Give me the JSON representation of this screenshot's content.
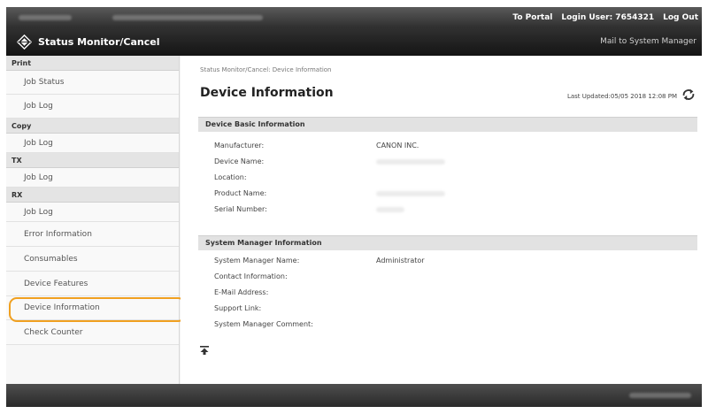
{
  "header": {
    "to_portal": "To Portal",
    "login_user": "Login User: 7654321",
    "log_out": "Log Out"
  },
  "titlebar": {
    "app_title": "Status Monitor/Cancel",
    "mail_link": "Mail to System Manager"
  },
  "sidebar": {
    "sections": [
      {
        "header": "Print",
        "items": [
          "Job Status",
          "Job Log"
        ]
      },
      {
        "header": "Copy",
        "items": [
          "Job Log"
        ]
      },
      {
        "header": "TX",
        "items": [
          "Job Log"
        ]
      },
      {
        "header": "RX",
        "items": [
          "Job Log"
        ]
      }
    ],
    "extra_items": [
      "Error Information",
      "Consumables",
      "Device Features",
      "Device Information",
      "Check Counter"
    ],
    "active_item": "Device Information"
  },
  "main": {
    "breadcrumb": "Status Monitor/Cancel: Device Information",
    "page_title": "Device Information",
    "last_updated": "Last Updated:05/05 2018 12:08 PM",
    "device_basic": {
      "title": "Device Basic Information",
      "fields": [
        {
          "label": "Manufacturer:",
          "value": "CANON INC."
        },
        {
          "label": "Device Name:",
          "value": ""
        },
        {
          "label": "Location:",
          "value": ""
        },
        {
          "label": "Product Name:",
          "value": ""
        },
        {
          "label": "Serial Number:",
          "value": ""
        }
      ]
    },
    "system_manager": {
      "title": "System Manager Information",
      "fields": [
        {
          "label": "System Manager Name:",
          "value": "Administrator"
        },
        {
          "label": "Contact Information:",
          "value": ""
        },
        {
          "label": "E-Mail Address:",
          "value": ""
        },
        {
          "label": "Support Link:",
          "value": ""
        },
        {
          "label": "System Manager Comment:",
          "value": ""
        }
      ]
    }
  },
  "colors": {
    "highlight": "#f0a020",
    "topbar": "#3a3a3a",
    "section_bar": "#e2e2e2"
  },
  "icons": [
    "canon-diamond-icon",
    "refresh-icon",
    "to-top-icon"
  ]
}
